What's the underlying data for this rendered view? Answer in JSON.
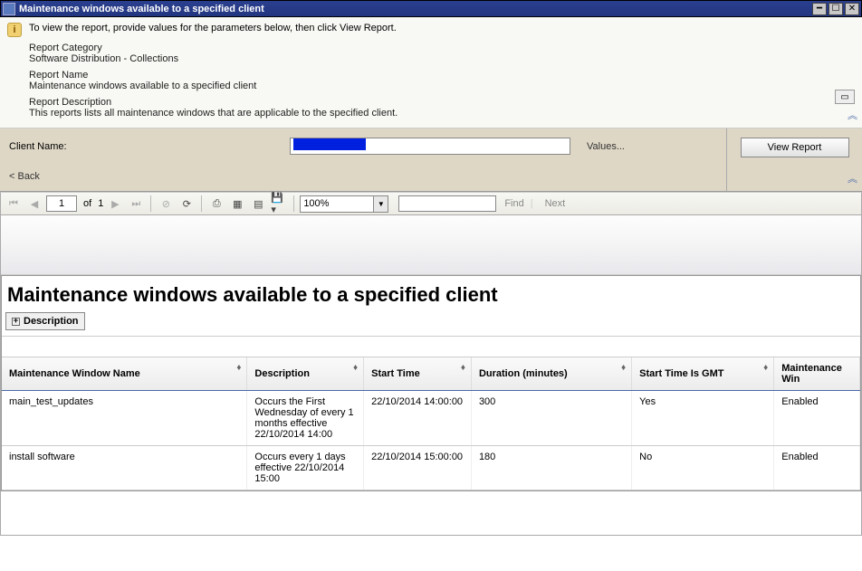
{
  "window": {
    "title": "Maintenance windows available to a specified client"
  },
  "info": {
    "intro": "To view the report, provide values for the parameters below, then click View Report.",
    "category_label": "Report Category",
    "category_value": "Software Distribution - Collections",
    "name_label": "Report Name",
    "name_value": "Maintenance windows available to a specified client",
    "desc_label": "Report Description",
    "desc_value": "This reports lists all maintenance windows that are applicable to the specified client."
  },
  "params": {
    "client_name_label": "Client Name:",
    "values_link": "Values...",
    "back_link": "< Back",
    "view_report_btn": "View Report"
  },
  "toolbar": {
    "page_current": "1",
    "of_label": "of",
    "page_total": "1",
    "zoom": "100%",
    "find_placeholder": "Find",
    "next_label": "Next"
  },
  "report": {
    "title": "Maintenance windows available to a specified client",
    "description_toggle": "Description",
    "columns": {
      "name": "Maintenance Window Name",
      "desc": "Description",
      "start": "Start Time",
      "duration": "Duration (minutes)",
      "gmt": "Start Time Is GMT",
      "mwin": "Maintenance Win"
    },
    "rows": [
      {
        "name": "main_test_updates",
        "desc": "Occurs the First Wednesday of every 1 months effective 22/10/2014 14:00",
        "start": "22/10/2014 14:00:00",
        "duration": "300",
        "gmt": "Yes",
        "mwin": "Enabled"
      },
      {
        "name": "install software",
        "desc": "Occurs every 1 days effective 22/10/2014 15:00",
        "start": "22/10/2014 15:00:00",
        "duration": "180",
        "gmt": "No",
        "mwin": "Enabled"
      }
    ]
  }
}
